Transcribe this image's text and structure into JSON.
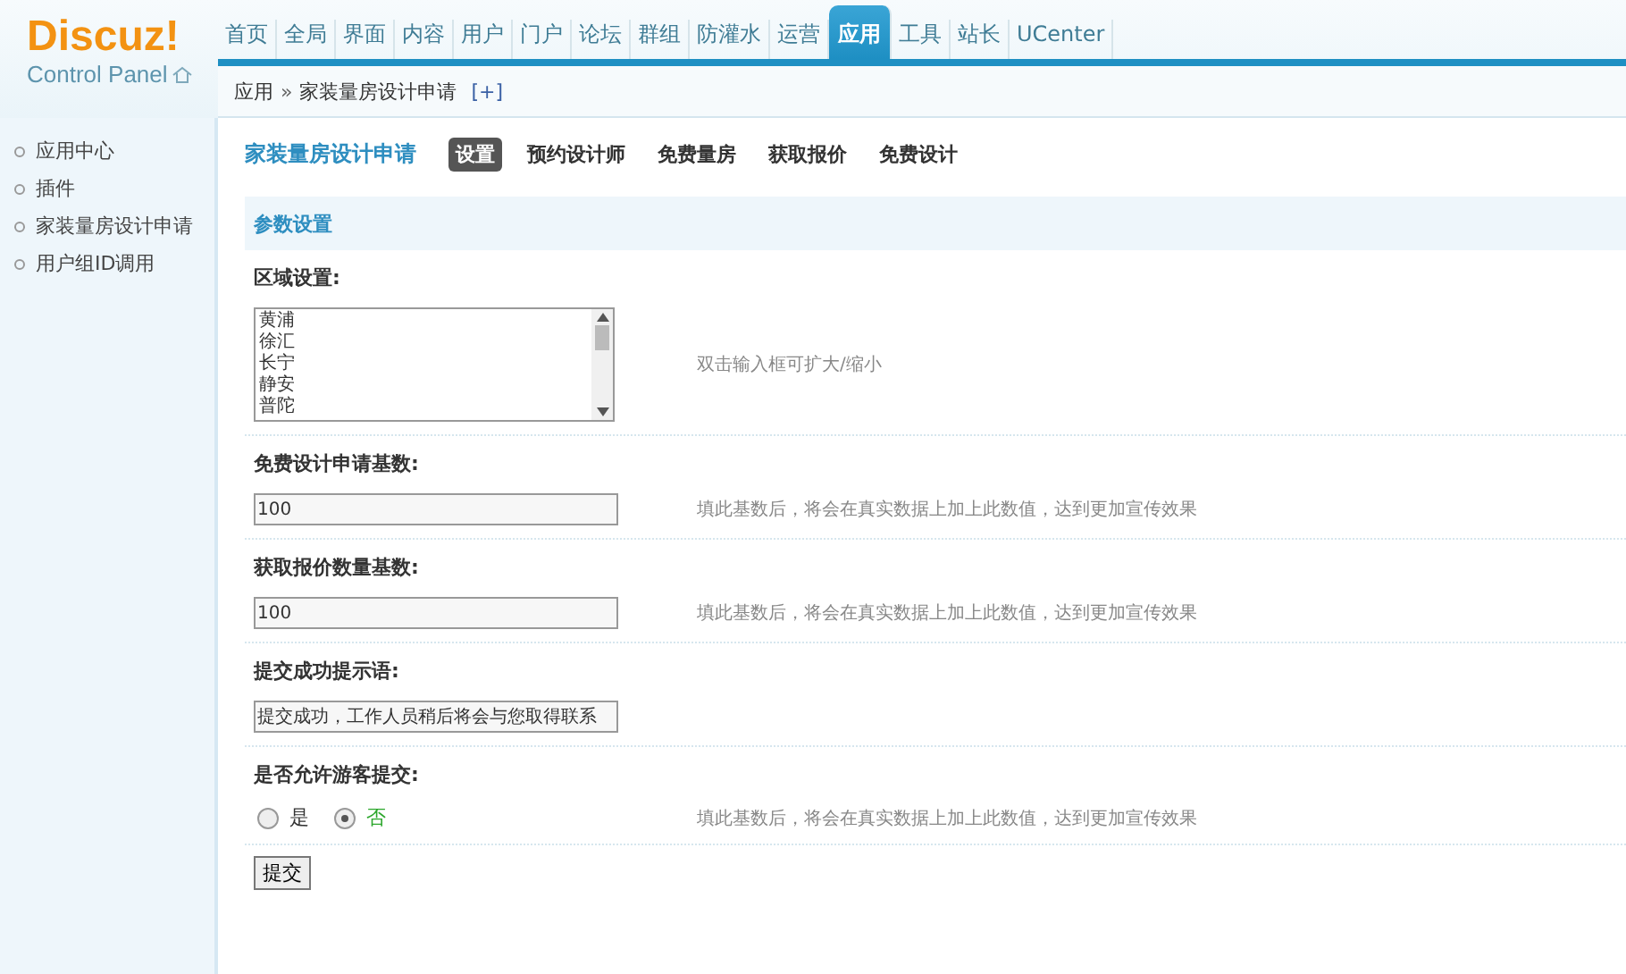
{
  "logo": {
    "name": "Discuz!",
    "subtitle": "Control Panel"
  },
  "nav": [
    {
      "label": "首页",
      "selected": false
    },
    {
      "label": "全局",
      "selected": false
    },
    {
      "label": "界面",
      "selected": false
    },
    {
      "label": "内容",
      "selected": false
    },
    {
      "label": "用户",
      "selected": false
    },
    {
      "label": "门户",
      "selected": false
    },
    {
      "label": "论坛",
      "selected": false
    },
    {
      "label": "群组",
      "selected": false
    },
    {
      "label": "防灌水",
      "selected": false
    },
    {
      "label": "运营",
      "selected": false
    },
    {
      "label": "应用",
      "selected": true
    },
    {
      "label": "工具",
      "selected": false
    },
    {
      "label": "站长",
      "selected": false
    },
    {
      "label": "UCenter",
      "selected": false
    }
  ],
  "breadcrumb": {
    "parent": "应用",
    "separator": "»",
    "current": "家装量房设计申请",
    "add": "[+]"
  },
  "sidebar": {
    "items": [
      {
        "label": "应用中心"
      },
      {
        "label": "插件"
      },
      {
        "label": "家装量房设计申请"
      },
      {
        "label": "用户组ID调用"
      }
    ]
  },
  "page": {
    "title": "家装量房设计申请",
    "tabs": [
      {
        "label": "设置",
        "selected": true
      },
      {
        "label": "预约设计师",
        "selected": false
      },
      {
        "label": "免费量房",
        "selected": false
      },
      {
        "label": "获取报价",
        "selected": false
      },
      {
        "label": "免费设计",
        "selected": false
      }
    ]
  },
  "section_title": "参数设置",
  "fields": [
    {
      "kind": "list",
      "label": "区域设置:",
      "options": [
        "黄浦",
        "徐汇",
        "长宁",
        "静安",
        "普陀"
      ],
      "hint": "双击输入框可扩大/缩小"
    },
    {
      "kind": "text",
      "label": "免费设计申请基数:",
      "value": "100",
      "hint": "填此基数后，将会在真实数据上加上此数值，达到更加宣传效果"
    },
    {
      "kind": "text",
      "label": "获取报价数量基数:",
      "value": "100",
      "hint": "填此基数后，将会在真实数据上加上此数值，达到更加宣传效果"
    },
    {
      "kind": "text",
      "label": "提交成功提示语:",
      "value": "提交成功，工作人员稍后将会与您取得联系"
    },
    {
      "kind": "radio",
      "label": "是否允许游客提交:",
      "options": [
        {
          "label": "是",
          "selected": false
        },
        {
          "label": "否",
          "selected": true
        }
      ],
      "hint": "填此基数后，将会在真实数据上加上此数值，达到更加宣传效果"
    }
  ],
  "submit": "提交"
}
